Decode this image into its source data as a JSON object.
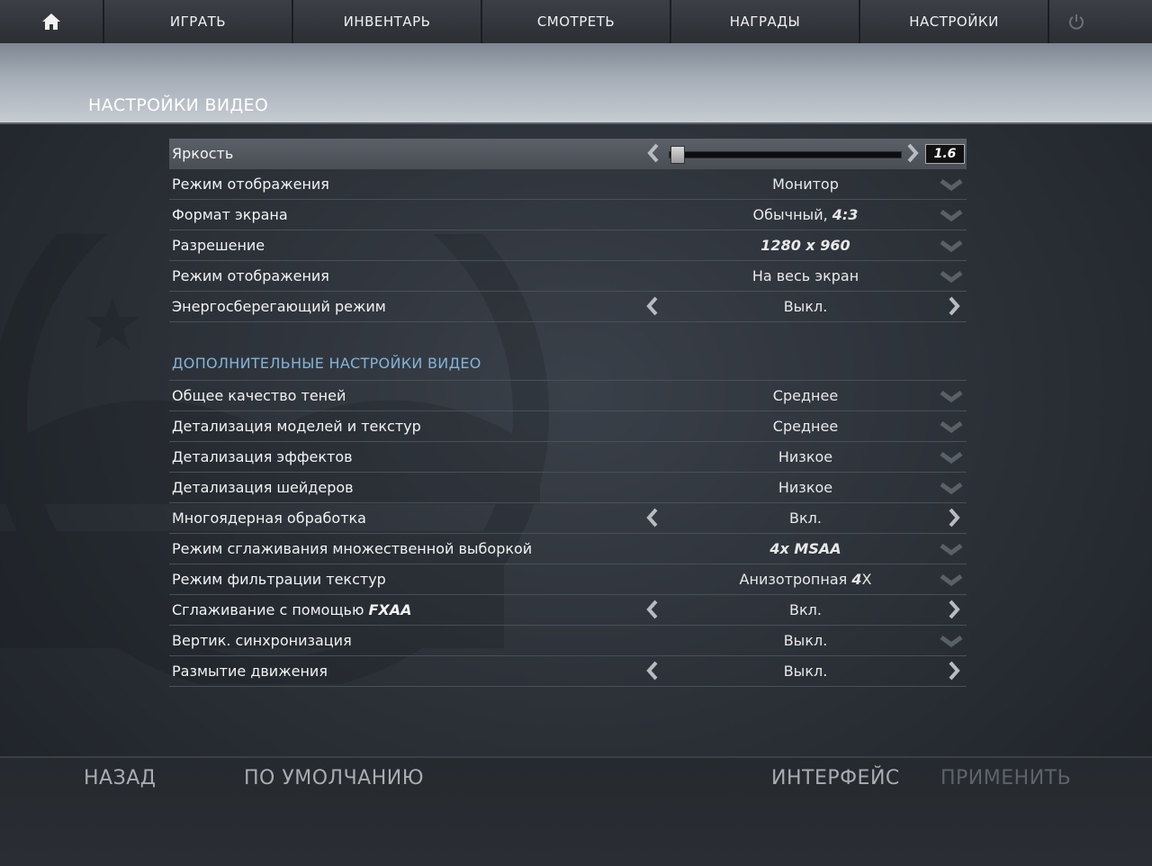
{
  "nav": {
    "tabs": [
      "ИГРАТЬ",
      "ИНВЕНТАРЬ",
      "СМОТРЕТЬ",
      "НАГРАДЫ",
      "НАСТРОЙКИ"
    ]
  },
  "page": {
    "title": "НАСТРОЙКИ ВИДЕО"
  },
  "brightness": {
    "label": "Яркость",
    "value": "1.6",
    "level": 0.02
  },
  "basic": [
    {
      "label": "Режим отображения",
      "value": "Монитор",
      "control": "dropdown"
    },
    {
      "label": "Формат экрана",
      "value": "Обычный, ",
      "value_em": "4:3",
      "control": "dropdown"
    },
    {
      "label": "Разрешение",
      "value": "1280 x 960",
      "control": "dropdown",
      "italic": true
    },
    {
      "label": "Режим отображения",
      "value": "На весь экран",
      "control": "dropdown"
    },
    {
      "label": "Энергосберегающий режим",
      "value": "Выкл.",
      "control": "arrows"
    }
  ],
  "advanced_title": "ДОПОЛНИТЕЛЬНЫЕ НАСТРОЙКИ ВИДЕО",
  "advanced": [
    {
      "label": "Общее качество теней",
      "value": "Среднее",
      "control": "dropdown"
    },
    {
      "label": "Детализация моделей и текстур",
      "value": "Среднее",
      "control": "dropdown"
    },
    {
      "label": "Детализация эффектов",
      "value": "Низкое",
      "control": "dropdown"
    },
    {
      "label": "Детализация шейдеров",
      "value": "Низкое",
      "control": "dropdown"
    },
    {
      "label": "Многоядерная обработка",
      "value": "Вкл.",
      "control": "arrows"
    },
    {
      "label": "Режим сглаживания множественной выборкой",
      "value": "4x MSAA",
      "control": "dropdown",
      "italic": true
    },
    {
      "label": "Режим фильтрации текстур",
      "value": "Анизотропная ",
      "value_em": "4",
      "value_tail": "X",
      "control": "dropdown"
    },
    {
      "label": "Сглаживание с помощью ",
      "label_em": "FXAA",
      "value": "Вкл.",
      "control": "arrows"
    },
    {
      "label": "Вертик. синхронизация",
      "value": "Выкл.",
      "control": "dropdown"
    },
    {
      "label": "Размытие движения",
      "value": "Выкл.",
      "control": "arrows"
    }
  ],
  "footer": {
    "back": "НАЗАД",
    "defaults": "ПО УМОЛЧАНИЮ",
    "interface": "ИНТЕРФЕЙС",
    "apply": "ПРИМЕНИТЬ"
  },
  "icons": {
    "home": "home-icon",
    "power": "power-icon",
    "left": "chevron-left-icon",
    "right": "chevron-right-icon",
    "dropdown": "chevron-down-icon"
  },
  "colors": {
    "section": "#82b4d8",
    "header_band": "#a6aeb8"
  }
}
